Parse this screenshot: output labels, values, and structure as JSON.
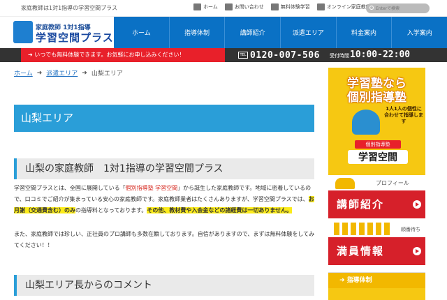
{
  "topbar": {
    "tagline": "家庭教師は1対1指導の学習空間プラス",
    "links": [
      {
        "label": "ホーム",
        "icon": "home-icon"
      },
      {
        "label": "お問い合わせ",
        "icon": "mail-icon"
      },
      {
        "label": "無料体験学習",
        "icon": "document-icon"
      },
      {
        "label": "オンライン家庭教師",
        "icon": "monitor-icon"
      }
    ],
    "search_placeholder": "Enterで検索"
  },
  "logo": {
    "line1": "家庭教師 1対1指導",
    "line2": "学習空間プラス"
  },
  "nav": [
    "ホーム",
    "指導体制",
    "講師紹介",
    "派遣エリア",
    "料金案内",
    "入学案内"
  ],
  "notice": {
    "message": "➜ いつでも無料体験できます。お気軽にお申し込みください！",
    "tel_badge": "TEL",
    "tel": "0120-007-506",
    "hours_label": "受付時間",
    "hours": "10:00-22:00"
  },
  "breadcrumb": {
    "home": "ホーム",
    "area": "派遣エリア",
    "current": "山梨エリア"
  },
  "page_title": "山梨エリア",
  "section1": {
    "title": "山梨の家庭教師　1対1指導の学習空間プラス",
    "p1_a": "学習空間プラスとは、全国に展開している「",
    "p1_link": "個別指導塾 学習空間",
    "p1_b": "」から誕生した家庭教師です。地域に密着しているので、口コミでご紹介が集まっている安心の家庭教師です。家庭教師業者はたくさんありますが、学習空間プラスでは、",
    "p1_hl1": "お月謝（交通費含む）のみ",
    "p1_c": "の指導料となっております。",
    "p1_hl2": "その他、教材費や入会金などの諸経費は一切ありません。",
    "p2": "また、家庭教師では珍しい、正社員のプロ講師も多数在籍しております。自信がありますので、まずは無料体験をしてみてください！！"
  },
  "section2": {
    "title": "山梨エリア長からのコメント"
  },
  "sidebar": {
    "banner_line1": "学習塾なら",
    "banner_line2": "個別指導塾",
    "banner_sub": "1人1人の個性に合わせて指導します",
    "banner_tag": "個別指導塾",
    "banner_name": "学習空間",
    "profile_label": "プロフィール",
    "teacher_btn": "講師紹介",
    "queue_label": "順番待ち",
    "full_btn": "満員情報",
    "subnav_item": "➜ 指導体制"
  }
}
